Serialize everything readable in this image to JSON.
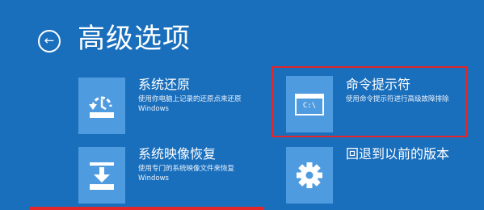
{
  "header": {
    "title": "高级选项",
    "back_icon": "back-arrow-icon"
  },
  "options": [
    {
      "id": "system-restore",
      "label": "系统还原",
      "description_line1": "使用你电脑上记录的还原点来还原",
      "description_line2": "Windows",
      "icon": "restore-icon"
    },
    {
      "id": "command-prompt",
      "label": "命令提示符",
      "description_line1": "使用命令提示符进行高级故障排除",
      "icon": "command-prompt-icon",
      "icon_text": "C:\\"
    },
    {
      "id": "system-image-recovery",
      "label": "系统映像恢复",
      "description_line1": "使用专门的系统映像文件来恢复",
      "description_line2": "Windows",
      "icon": "image-recovery-icon"
    },
    {
      "id": "go-back",
      "label": "回退到以前的版本",
      "icon": "gear-icon"
    }
  ],
  "colors": {
    "background": "#1a6fbd",
    "tile": "#4f9bdf",
    "highlight": "#e2262a",
    "text": "#ffffff"
  }
}
